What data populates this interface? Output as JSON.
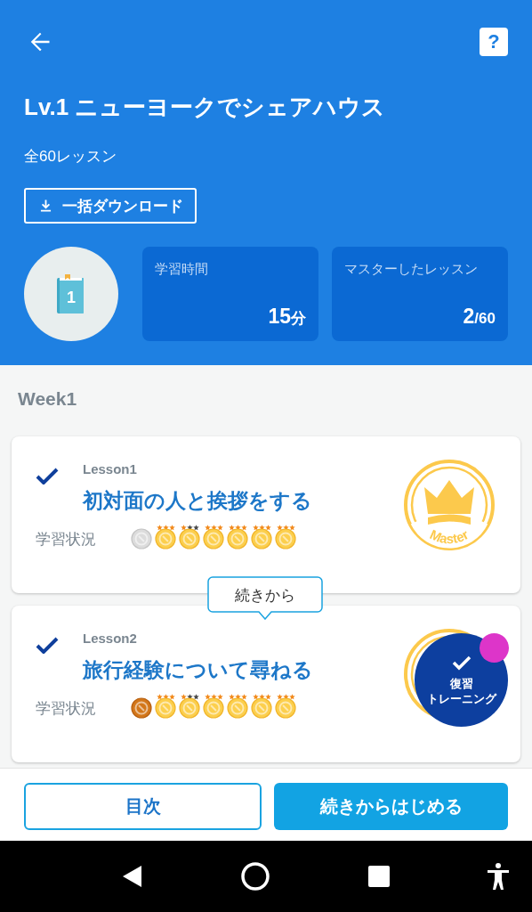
{
  "header": {
    "title": "Lv.1 ニューヨークでシェアハウス",
    "subtitle": "全60レッスン",
    "book_label": "1",
    "help_label": "?",
    "download_button": "一括ダウンロード",
    "stats": [
      {
        "label": "学習時間",
        "value": "15",
        "unit": "分"
      },
      {
        "label": "マスターしたレッスン",
        "value": "2",
        "unit": "/60"
      }
    ]
  },
  "week": {
    "title": "Week1",
    "lessons": [
      {
        "number": "Lesson1",
        "title": "初対面の人と挨拶をする",
        "status_label": "学習状況",
        "completed": true,
        "badge": {
          "kind": "master",
          "label": "Master"
        },
        "medals": [
          {
            "kind": "grey"
          },
          {
            "kind": "gold",
            "stars": 3
          },
          {
            "kind": "gold",
            "stars": 1
          },
          {
            "kind": "gold",
            "stars": 3
          },
          {
            "kind": "gold",
            "stars": 3
          },
          {
            "kind": "gold",
            "stars": 3
          },
          {
            "kind": "gold",
            "stars": 3
          }
        ]
      },
      {
        "number": "Lesson2",
        "title": "旅行経験について尋ねる",
        "status_label": "学習状況",
        "completed": true,
        "badge": {
          "kind": "master"
        },
        "tooltip": "続きから",
        "review": {
          "label_lines": [
            "復習",
            "トレーニング"
          ],
          "new_dot": true
        },
        "medals": [
          {
            "kind": "bronze"
          },
          {
            "kind": "gold",
            "stars": 3
          },
          {
            "kind": "gold",
            "stars": 1
          },
          {
            "kind": "gold",
            "stars": 3
          },
          {
            "kind": "gold",
            "stars": 3
          },
          {
            "kind": "gold",
            "stars": 3
          },
          {
            "kind": "gold",
            "stars": 3
          }
        ]
      }
    ]
  },
  "footer": {
    "buttons": [
      {
        "label": "目次",
        "kind": "outline"
      },
      {
        "label": "続きからはじめる",
        "kind": "filled"
      }
    ]
  }
}
